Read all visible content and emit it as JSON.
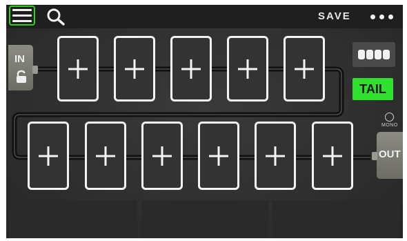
{
  "topbar": {
    "menu_icon": "hamburger-menu-icon",
    "search_icon": "search-icon",
    "save_label": "SAVE",
    "more_icon": "more-dots-icon"
  },
  "io": {
    "input_label": "IN",
    "input_lock_icon": "lock-icon",
    "output_label": "OUT"
  },
  "signal_path": {
    "row1_slots": [
      "+",
      "+",
      "+",
      "+",
      "+"
    ],
    "row2_slots": [
      "+",
      "+",
      "+",
      "+",
      "+",
      "+"
    ]
  },
  "side_controls": {
    "dsp_icon": "dsp-segments-icon",
    "tail_label": "TAIL",
    "mono_label": "MONO"
  },
  "colors": {
    "accent_green": "#34d11c",
    "tail_green": "#2fe02f",
    "background": "#303030",
    "slot_border": "#f4f4f4"
  }
}
